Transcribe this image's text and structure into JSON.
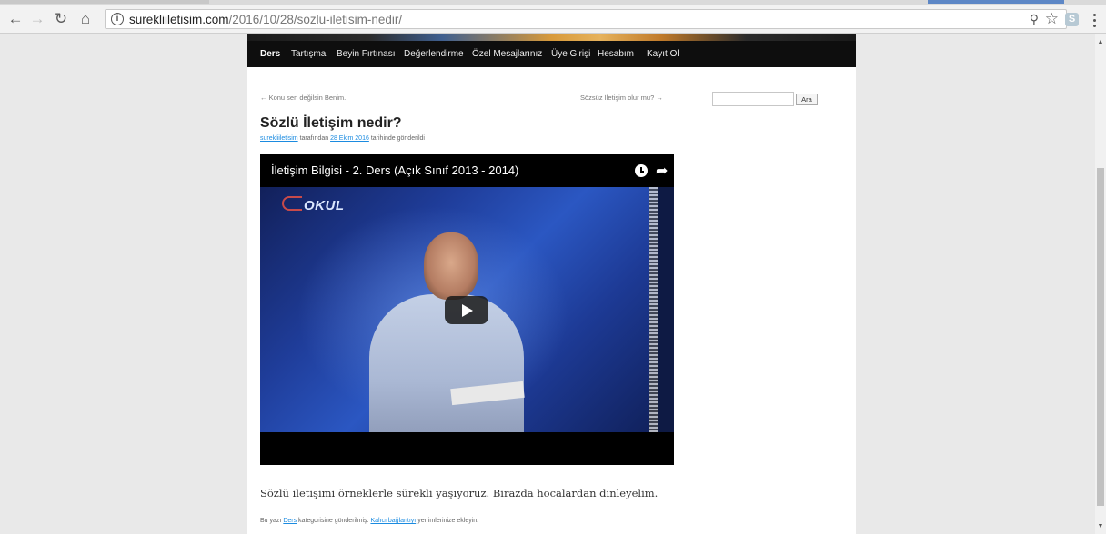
{
  "browser": {
    "url_host": "surekliiletisim.com",
    "url_path": "/2016/10/28/sozlu-iletisim-nedir/",
    "info_glyph": "i",
    "back_icon": "back-arrow-icon",
    "forward_icon": "forward-arrow-icon",
    "reload_icon": "reload-icon",
    "home_icon": "home-icon",
    "ext_letter": "S"
  },
  "nav": {
    "items": [
      "Ders",
      "Tartışma",
      "Beyin Fırtınası",
      "Değerlendirme",
      "Özel Mesajlarınız",
      "Üye Girişi",
      "Hesabım",
      "Kayıt Ol"
    ],
    "current": "Ders"
  },
  "post_nav": {
    "prev": "← Konu sen değilsin Benim.",
    "next": "Sözsüz İletişim olur mu? →"
  },
  "search": {
    "button": "Ara",
    "value": ""
  },
  "post": {
    "title": "Sözlü İletişim nedir?",
    "meta_author": "surekliiletisim",
    "meta_by": "tarafından",
    "meta_date": "28 Ekim 2016",
    "meta_suffix": "tarihinde gönderildi",
    "content": "Sözlü iletişimi örneklerle sürekli yaşıyoruz. Birazda hocalardan dinleyelim.",
    "utility_prefix": "Bu yazı",
    "utility_category": "Ders",
    "utility_mid": "kategorisine gönderilmiş.",
    "utility_permalink": "Kalıcı bağlantıyı",
    "utility_suffix": "yer imlerinize ekleyin."
  },
  "video": {
    "title": "İletişim Bilgisi - 2. Ders (Açık Sınıf 2013 - 2014)",
    "logo_text": "OKUL"
  },
  "colors": {
    "nav_bg": "#0e0e0e",
    "link": "#1b8be0",
    "page_bg": "#e9e9e9"
  }
}
